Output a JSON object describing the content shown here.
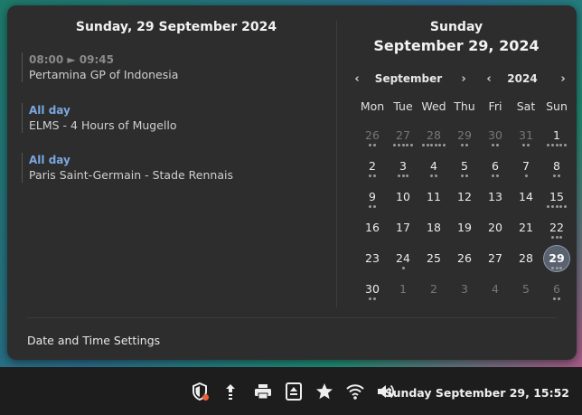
{
  "left_panel": {
    "title": "Sunday, 29 September 2024",
    "events": [
      {
        "time": "08:00 ► 09:45",
        "name": "Pertamina GP of Indonesia",
        "allday": false
      },
      {
        "time": "All day",
        "name": "ELMS - 4 Hours of Mugello",
        "allday": true
      },
      {
        "time": "All day",
        "name": "Paris Saint-Germain - Stade Rennais",
        "allday": true
      }
    ]
  },
  "calendar": {
    "weekday": "Sunday",
    "date": "September 29, 2024",
    "month_label": "September",
    "year_label": "2024",
    "prev_month": "‹",
    "next_month": "›",
    "prev_year": "‹",
    "next_year": "›",
    "weekdays": [
      "Mon",
      "Tue",
      "Wed",
      "Thu",
      "Fri",
      "Sat",
      "Sun"
    ],
    "weeks": [
      [
        {
          "d": "26",
          "o": true,
          "dots": 2
        },
        {
          "d": "27",
          "o": true,
          "dots": 5
        },
        {
          "d": "28",
          "o": true,
          "dots": 6
        },
        {
          "d": "29",
          "o": true,
          "dots": 2
        },
        {
          "d": "30",
          "o": true,
          "dots": 2
        },
        {
          "d": "31",
          "o": true,
          "dots": 2
        },
        {
          "d": "1",
          "o": false,
          "dots": 5
        }
      ],
      [
        {
          "d": "2",
          "o": false,
          "dots": 2
        },
        {
          "d": "3",
          "o": false,
          "dots": 3
        },
        {
          "d": "4",
          "o": false,
          "dots": 2
        },
        {
          "d": "5",
          "o": false,
          "dots": 2
        },
        {
          "d": "6",
          "o": false,
          "dots": 2
        },
        {
          "d": "7",
          "o": false,
          "dots": 1
        },
        {
          "d": "8",
          "o": false,
          "dots": 2
        }
      ],
      [
        {
          "d": "9",
          "o": false,
          "dots": 2
        },
        {
          "d": "10",
          "o": false,
          "dots": 0
        },
        {
          "d": "11",
          "o": false,
          "dots": 0
        },
        {
          "d": "12",
          "o": false,
          "dots": 0
        },
        {
          "d": "13",
          "o": false,
          "dots": 0
        },
        {
          "d": "14",
          "o": false,
          "dots": 0
        },
        {
          "d": "15",
          "o": false,
          "dots": 5
        }
      ],
      [
        {
          "d": "16",
          "o": false,
          "dots": 0
        },
        {
          "d": "17",
          "o": false,
          "dots": 0
        },
        {
          "d": "18",
          "o": false,
          "dots": 0
        },
        {
          "d": "19",
          "o": false,
          "dots": 0
        },
        {
          "d": "20",
          "o": false,
          "dots": 0
        },
        {
          "d": "21",
          "o": false,
          "dots": 0
        },
        {
          "d": "22",
          "o": false,
          "dots": 3
        }
      ],
      [
        {
          "d": "23",
          "o": false,
          "dots": 0
        },
        {
          "d": "24",
          "o": false,
          "dots": 1
        },
        {
          "d": "25",
          "o": false,
          "dots": 0
        },
        {
          "d": "26",
          "o": false,
          "dots": 0
        },
        {
          "d": "27",
          "o": false,
          "dots": 0
        },
        {
          "d": "28",
          "o": false,
          "dots": 0
        },
        {
          "d": "29",
          "o": false,
          "dots": 3,
          "today": true
        }
      ],
      [
        {
          "d": "30",
          "o": false,
          "dots": 2
        },
        {
          "d": "1",
          "o": true,
          "dots": 0
        },
        {
          "d": "2",
          "o": true,
          "dots": 0
        },
        {
          "d": "3",
          "o": true,
          "dots": 0
        },
        {
          "d": "4",
          "o": true,
          "dots": 0
        },
        {
          "d": "5",
          "o": true,
          "dots": 0
        },
        {
          "d": "6",
          "o": true,
          "dots": 2
        }
      ]
    ]
  },
  "settings_label": "Date and Time Settings",
  "taskbar": {
    "icons": [
      "shield-alert-icon",
      "upload-arrows-icon",
      "printer-icon",
      "eject-icon",
      "star-icon",
      "wifi-icon",
      "volume-icon"
    ],
    "clock": "Sunday September 29, 15:52"
  },
  "colors": {
    "allday": "#7aa7e0",
    "today_bg": "#5a6270",
    "badge": "#e8603c"
  }
}
